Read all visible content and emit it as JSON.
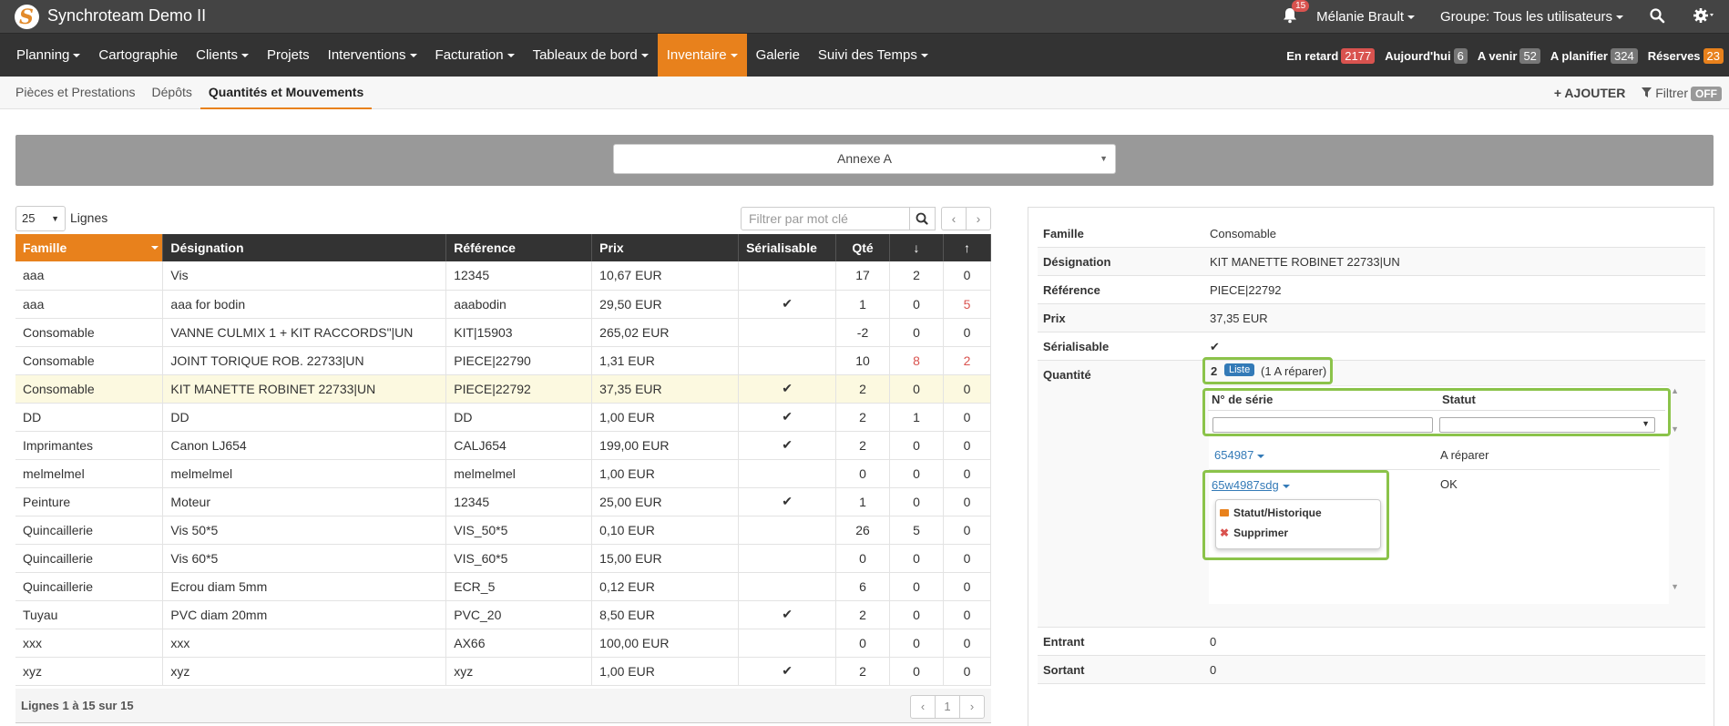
{
  "app": {
    "title": "Synchroteam Demo II",
    "logo_letter": "S",
    "notif_count": "15",
    "user": "Mélanie Brault",
    "group": "Groupe: Tous les utilisateurs"
  },
  "nav": {
    "items": [
      {
        "label": "Planning",
        "dropdown": true
      },
      {
        "label": "Cartographie",
        "dropdown": false
      },
      {
        "label": "Clients",
        "dropdown": true
      },
      {
        "label": "Projets",
        "dropdown": false
      },
      {
        "label": "Interventions",
        "dropdown": true
      },
      {
        "label": "Facturation",
        "dropdown": true
      },
      {
        "label": "Tableaux de bord",
        "dropdown": true
      },
      {
        "label": "Inventaire",
        "dropdown": true,
        "active": true
      },
      {
        "label": "Galerie",
        "dropdown": false
      },
      {
        "label": "Suivi des Temps",
        "dropdown": true
      }
    ],
    "stats": [
      {
        "label": "En retard",
        "count": "2177",
        "color": "#d9534f"
      },
      {
        "label": "Aujourd'hui",
        "count": "6",
        "color": "#777777"
      },
      {
        "label": "A venir",
        "count": "52",
        "color": "#777777"
      },
      {
        "label": "A planifier",
        "count": "324",
        "color": "#777777"
      },
      {
        "label": "Réserves",
        "count": "23",
        "color": "#e8811c"
      }
    ]
  },
  "subnav": {
    "tabs": [
      {
        "label": "Pièces et Prestations",
        "active": false
      },
      {
        "label": "Dépôts",
        "active": false
      },
      {
        "label": "Quantités et Mouvements",
        "active": true
      }
    ],
    "add_label": "AJOUTER",
    "add_plus": "+",
    "filter_label": "Filtrer",
    "filter_state": "OFF"
  },
  "depot": {
    "selected": "Annexe A",
    "arrow": "▼"
  },
  "table": {
    "page_length": "25",
    "page_length_label": "Lignes",
    "search_placeholder": "Filtrer par mot clé",
    "prev": "‹",
    "next": "›",
    "columns": [
      "Famille",
      "Désignation",
      "Référence",
      "Prix",
      "Sérialisable",
      "Qté",
      "↓",
      "↑"
    ],
    "rows": [
      {
        "famille": "aaa",
        "designation": "Vis",
        "reference": "12345",
        "prix": "10,67 EUR",
        "serial": "",
        "qte": "17",
        "in": "2",
        "out": "0"
      },
      {
        "famille": "aaa",
        "designation": "aaa for bodin",
        "reference": "aaabodin",
        "prix": "29,50 EUR",
        "serial": "✔",
        "qte": "1",
        "in": "0",
        "out": "5",
        "out_red": true
      },
      {
        "famille": "Consomable",
        "designation": "VANNE CULMIX 1 + KIT RACCORDS\"|UN",
        "reference": "KIT|15903",
        "prix": "265,02 EUR",
        "serial": "",
        "qte": "-2",
        "in": "0",
        "out": "0"
      },
      {
        "famille": "Consomable",
        "designation": "JOINT TORIQUE ROB. 22733|UN",
        "reference": "PIECE|22790",
        "prix": "1,31 EUR",
        "serial": "",
        "qte": "10",
        "in": "8",
        "in_red": true,
        "out": "2",
        "out_red": true
      },
      {
        "famille": "Consomable",
        "designation": "KIT MANETTE ROBINET 22733|UN",
        "reference": "PIECE|22792",
        "prix": "37,35 EUR",
        "serial": "✔",
        "qte": "2",
        "in": "0",
        "out": "0",
        "selected": true
      },
      {
        "famille": "DD",
        "designation": "DD",
        "reference": "DD",
        "prix": "1,00 EUR",
        "serial": "✔",
        "qte": "2",
        "in": "1",
        "out": "0"
      },
      {
        "famille": "Imprimantes",
        "designation": "Canon LJ654",
        "reference": "CALJ654",
        "prix": "199,00 EUR",
        "serial": "✔",
        "qte": "2",
        "in": "0",
        "out": "0"
      },
      {
        "famille": "melmelmel",
        "designation": "melmelmel",
        "reference": "melmelmel",
        "prix": "1,00 EUR",
        "serial": "",
        "qte": "0",
        "in": "0",
        "out": "0"
      },
      {
        "famille": "Peinture",
        "designation": "Moteur",
        "reference": "12345",
        "prix": "25,00 EUR",
        "serial": "✔",
        "qte": "1",
        "in": "0",
        "out": "0"
      },
      {
        "famille": "Quincaillerie",
        "designation": "Vis 50*5",
        "reference": "VIS_50*5",
        "prix": "0,10 EUR",
        "serial": "",
        "qte": "26",
        "in": "5",
        "out": "0"
      },
      {
        "famille": "Quincaillerie",
        "designation": "Vis 60*5",
        "reference": "VIS_60*5",
        "prix": "15,00 EUR",
        "serial": "",
        "qte": "0",
        "in": "0",
        "out": "0"
      },
      {
        "famille": "Quincaillerie",
        "designation": "Ecrou diam 5mm",
        "reference": "ECR_5",
        "prix": "0,12 EUR",
        "serial": "",
        "qte": "6",
        "in": "0",
        "out": "0"
      },
      {
        "famille": "Tuyau",
        "designation": "PVC diam 20mm",
        "reference": "PVC_20",
        "prix": "8,50 EUR",
        "serial": "✔",
        "qte": "2",
        "in": "0",
        "out": "0"
      },
      {
        "famille": "xxx",
        "designation": "xxx",
        "reference": "AX66",
        "prix": "100,00 EUR",
        "serial": "",
        "qte": "0",
        "in": "0",
        "out": "0"
      },
      {
        "famille": "xyz",
        "designation": "xyz",
        "reference": "xyz",
        "prix": "1,00 EUR",
        "serial": "✔",
        "qte": "2",
        "in": "0",
        "out": "0"
      }
    ],
    "footer": "Lignes 1 à 15 sur 15",
    "current_page": "1"
  },
  "detail": {
    "famille": {
      "label": "Famille",
      "value": "Consomable"
    },
    "designation": {
      "label": "Désignation",
      "value": "KIT MANETTE ROBINET 22733|UN"
    },
    "reference": {
      "label": "Référence",
      "value": "PIECE|22792"
    },
    "prix": {
      "label": "Prix",
      "value": "37,35 EUR"
    },
    "serialisable": {
      "label": "Sérialisable",
      "value": "✔"
    },
    "quantite": {
      "label": "Quantité",
      "value": "2",
      "liste": "Liste",
      "note": "(1 A réparer)"
    },
    "entrant": {
      "label": "Entrant",
      "value": "0"
    },
    "sortant": {
      "label": "Sortant",
      "value": "0"
    }
  },
  "serials": {
    "col_serial": "N° de série",
    "col_status": "Statut",
    "rows": [
      {
        "serial": "654987",
        "status": "A réparer"
      },
      {
        "serial": "65w4987sdg",
        "status": "OK"
      }
    ],
    "menu": {
      "history": "Statut/Historique",
      "delete": "Supprimer",
      "delete_mark": "✖"
    }
  },
  "colors": {
    "accent": "#e8811c",
    "highlight_box": "#8bc34a",
    "link": "#337ab7"
  }
}
